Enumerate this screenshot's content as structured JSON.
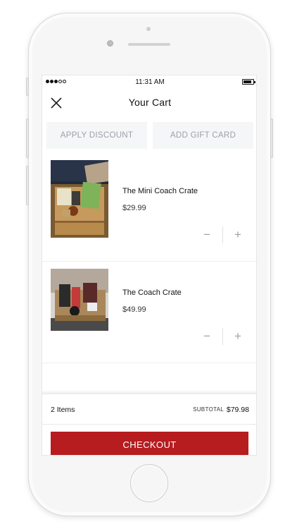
{
  "status_bar": {
    "time": "11:31 AM"
  },
  "nav": {
    "title": "Your Cart",
    "close_icon": "close-icon"
  },
  "actions": {
    "apply_discount": "APPLY DISCOUNT",
    "add_gift_card": "ADD GIFT CARD"
  },
  "cart_items": [
    {
      "name": "The Mini Coach Crate",
      "price": "$29.99",
      "image": "product-photo"
    },
    {
      "name": "The Coach Crate",
      "price": "$49.99",
      "image": "product-photo"
    }
  ],
  "stepper": {
    "minus": "−",
    "plus": "+"
  },
  "summary": {
    "items_count": "2 Items",
    "subtotal_label": "SUBTOTAL",
    "subtotal_value": "$79.98"
  },
  "checkout": {
    "label": "CHECKOUT"
  },
  "colors": {
    "accent": "#b71c1f",
    "muted_text": "#9aa1a9",
    "button_bg": "#f5f6f7"
  }
}
